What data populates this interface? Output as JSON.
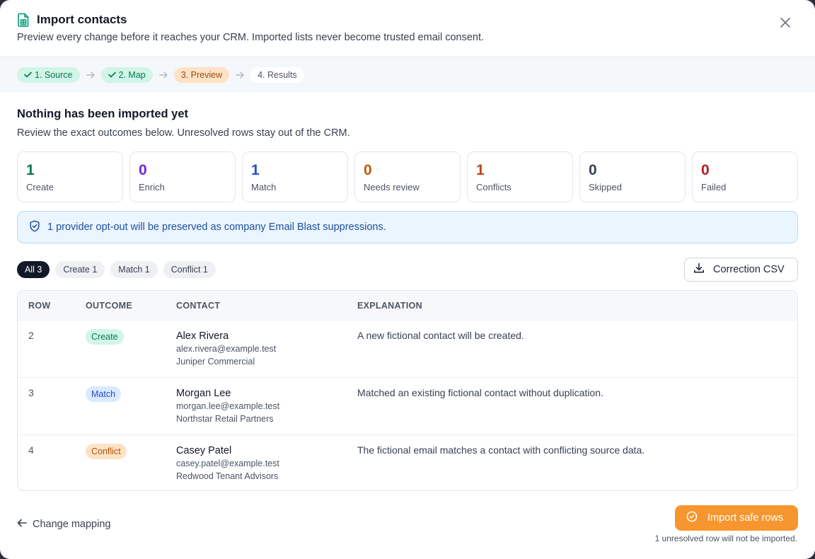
{
  "header": {
    "title": "Import contacts",
    "subtitle": "Preview every change before it reaches your CRM. Imported lists never become trusted email consent."
  },
  "steps": [
    {
      "label": "1. Source",
      "state": "done"
    },
    {
      "label": "2. Map",
      "state": "done"
    },
    {
      "label": "3. Preview",
      "state": "active"
    },
    {
      "label": "4. Results",
      "state": "pending"
    }
  ],
  "summary": {
    "title": "Nothing has been imported yet",
    "subtitle": "Review the exact outcomes below. Unresolved rows stay out of the CRM."
  },
  "stats": [
    {
      "value": "1",
      "label": "Create",
      "color": "#047857"
    },
    {
      "value": "0",
      "label": "Enrich",
      "color": "#6d28d9"
    },
    {
      "value": "1",
      "label": "Match",
      "color": "#1d4ed8"
    },
    {
      "value": "0",
      "label": "Needs review",
      "color": "#c2570c"
    },
    {
      "value": "1",
      "label": "Conflicts",
      "color": "#c2410c"
    },
    {
      "value": "0",
      "label": "Skipped",
      "color": "#374151"
    },
    {
      "value": "0",
      "label": "Failed",
      "color": "#b91c1c"
    }
  ],
  "notice": {
    "text": "1 provider opt-out will be preserved as company Email Blast suppressions.",
    "icon": "shield-check-icon"
  },
  "filters": [
    {
      "label": "All 3",
      "active": true
    },
    {
      "label": "Create 1",
      "active": false
    },
    {
      "label": "Match 1",
      "active": false
    },
    {
      "label": "Conflict 1",
      "active": false
    }
  ],
  "csv_button": {
    "label": "Correction CSV",
    "icon": "download-icon"
  },
  "table": {
    "headers": {
      "row": "ROW",
      "outcome": "OUTCOME",
      "contact": "CONTACT",
      "explanation": "EXPLANATION"
    },
    "rows": [
      {
        "row": "2",
        "outcome": "Create",
        "type": "create",
        "name": "Alex Rivera",
        "email": "alex.rivera@example.test",
        "company": "Juniper Commercial",
        "explanation": "A new fictional contact will be created."
      },
      {
        "row": "3",
        "outcome": "Match",
        "type": "match",
        "name": "Morgan Lee",
        "email": "morgan.lee@example.test",
        "company": "Northstar Retail Partners",
        "explanation": "Matched an existing fictional contact without duplication."
      },
      {
        "row": "4",
        "outcome": "Conflict",
        "type": "conflict",
        "name": "Casey Patel",
        "email": "casey.patel@example.test",
        "company": "Redwood Tenant Advisors",
        "explanation": "The fictional email matches a contact with conflicting source data."
      }
    ]
  },
  "footer": {
    "back_label": "Change mapping",
    "import_label": "Import safe rows",
    "note": "1 unresolved row will not be imported."
  }
}
